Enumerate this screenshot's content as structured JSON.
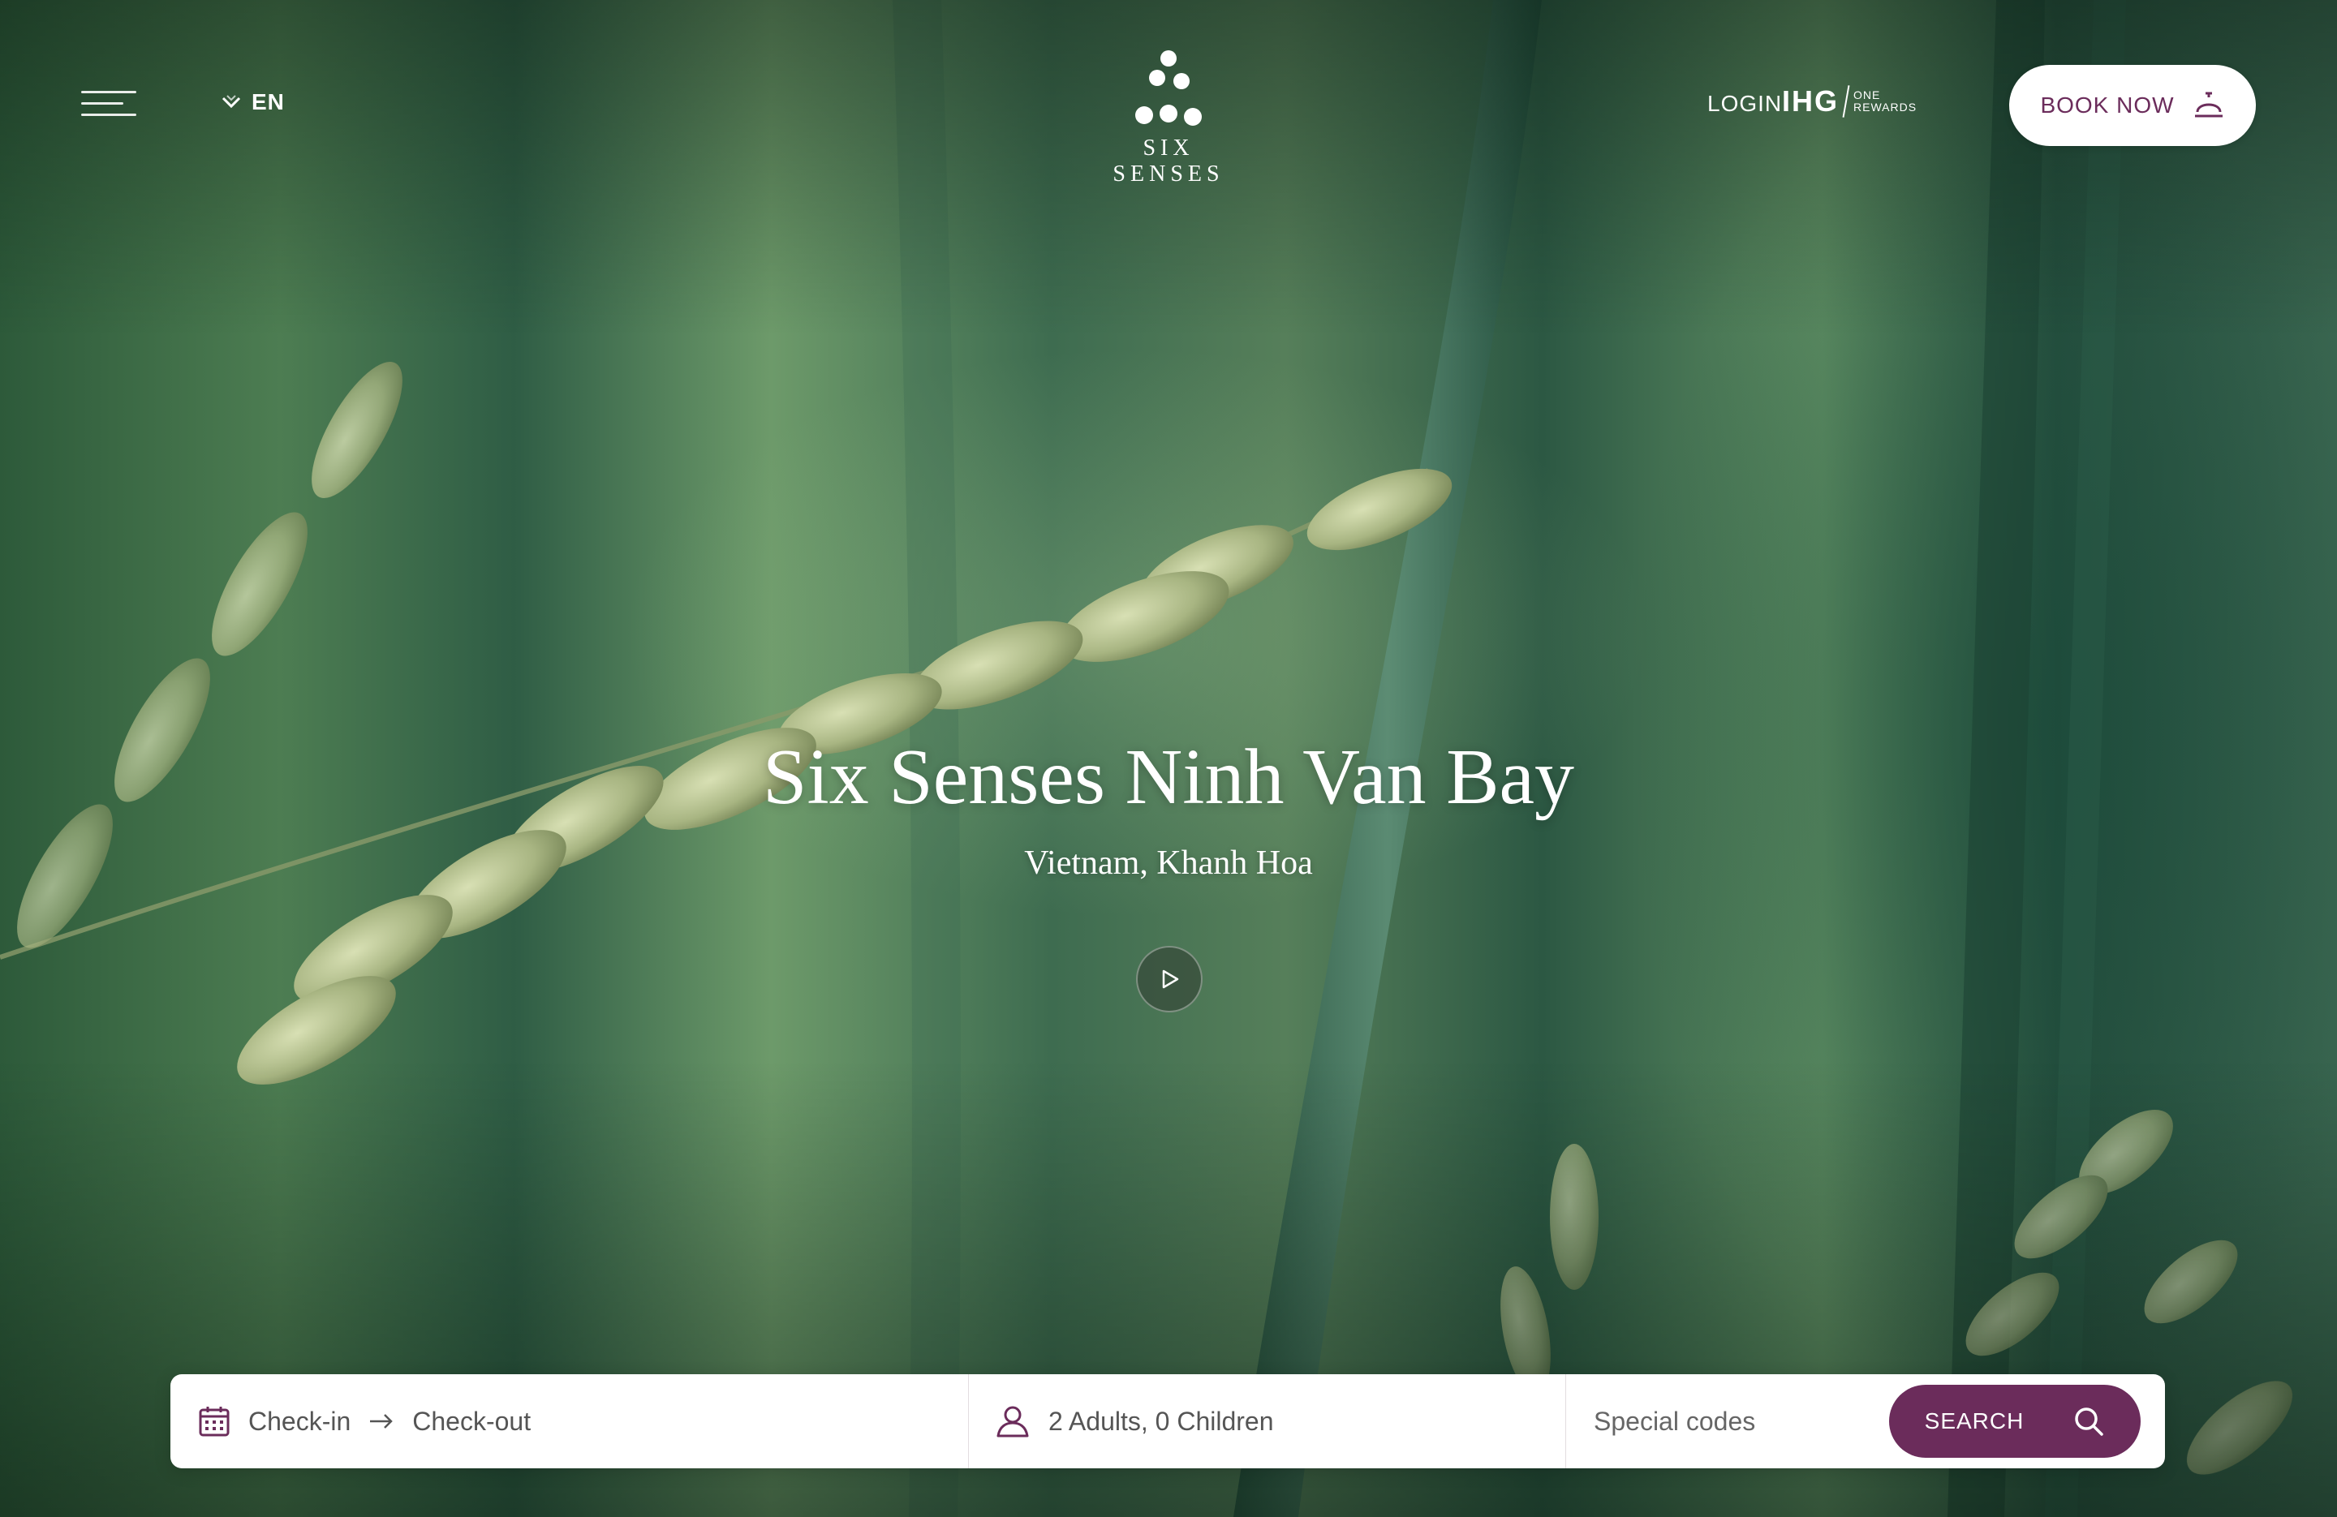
{
  "header": {
    "language": "EN",
    "brand_name": "SIX SENSES",
    "login_label": "LOGIN",
    "ihg_label": "IHG",
    "ihg_sub_line1": "ONE",
    "ihg_sub_line2": "REWARDS",
    "book_now_label": "BOOK NOW"
  },
  "hero": {
    "title": "Six Senses Ninh Van Bay",
    "subtitle": "Vietnam, Khanh Hoa"
  },
  "booking": {
    "checkin_label": "Check-in",
    "checkout_label": "Check-out",
    "guests_label": "2 Adults, 0 Children",
    "codes_placeholder": "Special codes",
    "search_label": "SEARCH"
  },
  "colors": {
    "accent": "#6b2c5b",
    "white": "#ffffff"
  },
  "icons": {
    "menu": "hamburger-icon",
    "language": "chevron-down-icon",
    "book": "service-bell-icon",
    "play": "play-icon",
    "calendar": "calendar-icon",
    "arrow": "arrow-right-icon",
    "guests": "user-icon",
    "search": "search-icon"
  }
}
